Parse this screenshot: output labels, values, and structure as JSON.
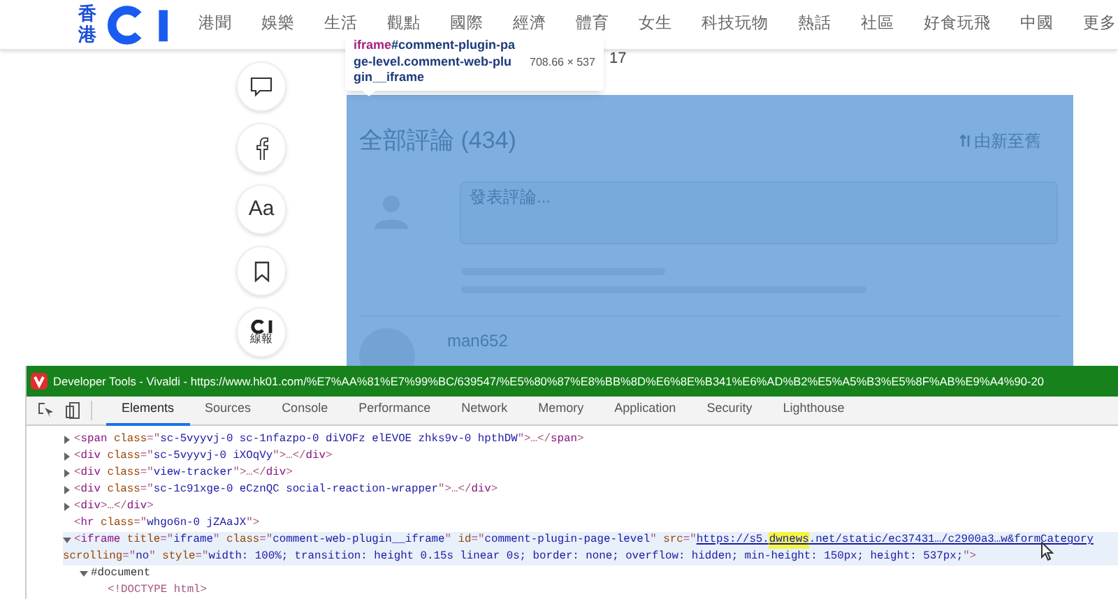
{
  "site": {
    "logo_text": "香港",
    "nav": [
      "港聞",
      "娛樂",
      "生活",
      "觀點",
      "國際",
      "經濟",
      "體育",
      "女生",
      "科技玩物",
      "熱話",
      "社區",
      "好食玩飛",
      "中國",
      "更多"
    ],
    "date_fragment": "17"
  },
  "share_bar": [
    {
      "kind": "comment"
    },
    {
      "kind": "facebook"
    },
    {
      "kind": "font",
      "label": "Aa"
    },
    {
      "kind": "bookmark"
    },
    {
      "kind": "brand",
      "label": "線報"
    }
  ],
  "comments": {
    "title": "全部評論 (434)",
    "sort": "由新至舊",
    "input": {
      "placeholder": "發表評論..."
    },
    "first_user": "man652"
  },
  "inspect_tooltip": {
    "tag": "iframe",
    "selector": "#comment-plugin-page-level.comment-web-plugin__iframe",
    "size": "708.66 × 537"
  },
  "devtools": {
    "title": "Developer Tools - Vivaldi - https://www.hk01.com/%E7%AA%81%E7%99%BC/639547/%E5%80%87%E8%BB%8D%E6%8E%B341%E6%AD%B2%E5%A5%B3%E5%8F%AB%E9%A4%90-20",
    "tabs": [
      {
        "label": "Elements",
        "selected": true
      },
      {
        "label": "Sources",
        "selected": false
      },
      {
        "label": "Console",
        "selected": false
      },
      {
        "label": "Performance",
        "selected": false
      },
      {
        "label": "Network",
        "selected": false
      },
      {
        "label": "Memory",
        "selected": false
      },
      {
        "label": "Application",
        "selected": false
      },
      {
        "label": "Security",
        "selected": false
      },
      {
        "label": "Lighthouse",
        "selected": false
      }
    ],
    "nodes": [
      {
        "expanded": false,
        "selected": false,
        "tokens": [
          {
            "kind": "p",
            "text": "<"
          },
          {
            "kind": "tag",
            "text": "span"
          },
          {
            "kind": "attr",
            "text": " class"
          },
          {
            "kind": "p",
            "text": "=\""
          },
          {
            "kind": "val",
            "text": "sc-5vyyvj-0 sc-1nfazpo-0 diVOFz elEVOE zhks9v-0 hpthDW"
          },
          {
            "kind": "p",
            "text": "\">…</"
          },
          {
            "kind": "tag",
            "text": "span"
          },
          {
            "kind": "p",
            "text": ">"
          }
        ]
      },
      {
        "expanded": false,
        "selected": false,
        "tokens": [
          {
            "kind": "p",
            "text": "<"
          },
          {
            "kind": "tag",
            "text": "div"
          },
          {
            "kind": "attr",
            "text": " class"
          },
          {
            "kind": "p",
            "text": "=\""
          },
          {
            "kind": "val",
            "text": "sc-5vyyvj-0 iXOqVy"
          },
          {
            "kind": "p",
            "text": "\">…</"
          },
          {
            "kind": "tag",
            "text": "div"
          },
          {
            "kind": "p",
            "text": ">"
          }
        ]
      },
      {
        "expanded": false,
        "selected": false,
        "tokens": [
          {
            "kind": "p",
            "text": "<"
          },
          {
            "kind": "tag",
            "text": "div"
          },
          {
            "kind": "attr",
            "text": " class"
          },
          {
            "kind": "p",
            "text": "=\""
          },
          {
            "kind": "val",
            "text": "view-tracker"
          },
          {
            "kind": "p",
            "text": "\">…</"
          },
          {
            "kind": "tag",
            "text": "div"
          },
          {
            "kind": "p",
            "text": ">"
          }
        ]
      },
      {
        "expanded": false,
        "selected": false,
        "tokens": [
          {
            "kind": "p",
            "text": "<"
          },
          {
            "kind": "tag",
            "text": "div"
          },
          {
            "kind": "attr",
            "text": " class"
          },
          {
            "kind": "p",
            "text": "=\""
          },
          {
            "kind": "val",
            "text": "sc-1c91xge-0 eCznQC social-reaction-wrapper"
          },
          {
            "kind": "p",
            "text": "\">…</"
          },
          {
            "kind": "tag",
            "text": "div"
          },
          {
            "kind": "p",
            "text": ">"
          }
        ]
      },
      {
        "expanded": false,
        "selected": false,
        "tokens": [
          {
            "kind": "p",
            "text": "<"
          },
          {
            "kind": "tag",
            "text": "div"
          },
          {
            "kind": "p",
            "text": ">…</"
          },
          {
            "kind": "tag",
            "text": "div"
          },
          {
            "kind": "p",
            "text": ">"
          }
        ]
      },
      {
        "selected": false,
        "tokens": [
          {
            "kind": "p",
            "text": "<"
          },
          {
            "kind": "tag",
            "text": "hr"
          },
          {
            "kind": "attr",
            "text": " class"
          },
          {
            "kind": "p",
            "text": "=\""
          },
          {
            "kind": "val",
            "text": "whgo6n-0 jZAaJX"
          },
          {
            "kind": "p",
            "text": "\">"
          }
        ]
      },
      {
        "expanded": true,
        "selected": true,
        "tokens": [
          {
            "kind": "p",
            "text": "<"
          },
          {
            "kind": "tag",
            "text": "iframe"
          },
          {
            "kind": "attr",
            "text": " title"
          },
          {
            "kind": "p",
            "text": "=\""
          },
          {
            "kind": "val",
            "text": "iframe"
          },
          {
            "kind": "p",
            "text": "\""
          },
          {
            "kind": "attr",
            "text": " class"
          },
          {
            "kind": "p",
            "text": "=\""
          },
          {
            "kind": "val",
            "text": "comment-web-plugin__iframe"
          },
          {
            "kind": "p",
            "text": "\""
          },
          {
            "kind": "attr",
            "text": " id"
          },
          {
            "kind": "p",
            "text": "=\""
          },
          {
            "kind": "val",
            "text": "comment-plugin-page-level"
          },
          {
            "kind": "p",
            "text": "\""
          },
          {
            "kind": "attr",
            "text": " src"
          },
          {
            "kind": "p",
            "text": "=\""
          },
          {
            "kind": "link",
            "text": "https://s5."
          },
          {
            "kind": "mark",
            "text": "dwnews"
          },
          {
            "kind": "link",
            "text": ".net/static/ec37431…/c2900a3…w&formCategory"
          }
        ],
        "continuation": [
          {
            "kind": "attr",
            "text": "scrolling"
          },
          {
            "kind": "p",
            "text": "=\""
          },
          {
            "kind": "val",
            "text": "no"
          },
          {
            "kind": "p",
            "text": "\""
          },
          {
            "kind": "attr",
            "text": " style"
          },
          {
            "kind": "p",
            "text": "=\""
          },
          {
            "kind": "val",
            "text": "width: 100%; transition: height 0.15s linear 0s; border: none; overflow: hidden; min-height: 150px; height: 537px;"
          },
          {
            "kind": "p",
            "text": "\">"
          }
        ],
        "children": [
          {
            "expanded": true,
            "selected": false,
            "tokens": [
              {
                "kind": "doc",
                "text": "#document"
              }
            ],
            "children": [
              {
                "selected": false,
                "tokens": [
                  {
                    "kind": "p",
                    "text": "<!DOCTYPE html>"
                  }
                ]
              }
            ]
          }
        ]
      }
    ]
  }
}
